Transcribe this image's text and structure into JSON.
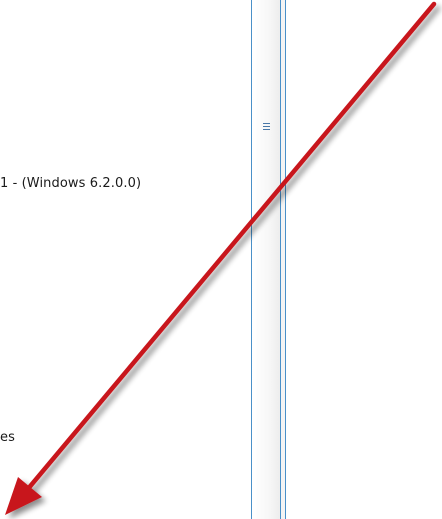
{
  "content": {
    "version_line": "1 - (Windows 6.2.0.0)",
    "trailing_line": "es"
  },
  "splitter": {
    "grip_icon": "grip-lines-icon"
  },
  "annotation": {
    "arrow_color": "#c8161d",
    "shadow_color": "#9a9a9a",
    "direction": "down-left"
  }
}
